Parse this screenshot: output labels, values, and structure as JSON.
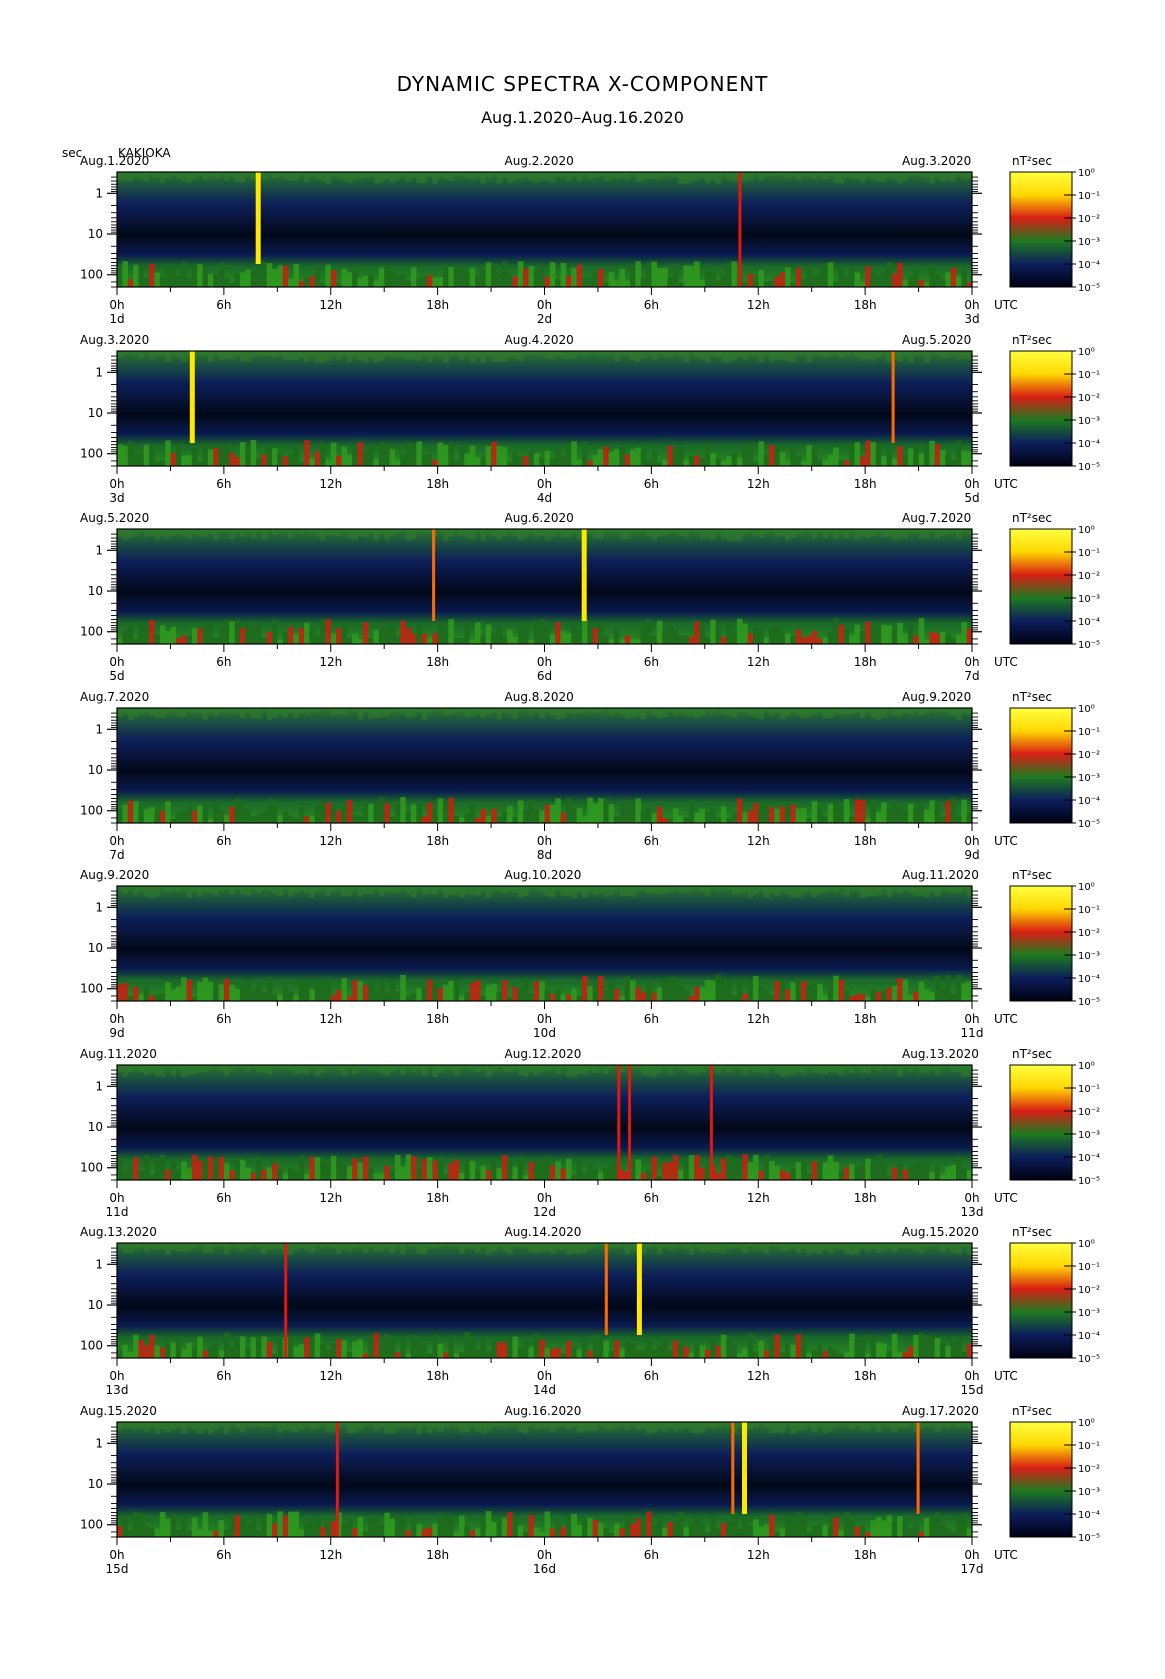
{
  "title": "DYNAMIC SPECTRA X-COMPONENT",
  "subtitle": "Aug.1.2020–Aug.16.2020",
  "y_axis_unit": "sec",
  "station": "KAKIOKA",
  "colorbar_unit": "nT²sec",
  "time_unit": "UTC",
  "chart_data": {
    "type": "heatmap",
    "y_scale": "log",
    "y_inverted": true,
    "y_ticks": [
      "1",
      "10",
      "100"
    ],
    "x_ticks": [
      "0h",
      "6h",
      "12h",
      "18h",
      "0h",
      "6h",
      "12h",
      "18h",
      "0h"
    ],
    "colorbar_ticks": [
      "10⁰",
      "10⁻¹",
      "10⁻²",
      "10⁻³",
      "10⁻⁴",
      "10⁻⁵"
    ],
    "colorscale": [
      "#000010",
      "#0c1e5c",
      "#1e7a20",
      "#d81e14",
      "#ffd700",
      "#ffff40"
    ],
    "panels": [
      {
        "left_date": "Aug.1.2020",
        "mid_date": "Aug.2.2020",
        "right_date": "Aug.3.2020",
        "day_labels": [
          "1d",
          "2d",
          "3d"
        ],
        "events": [
          {
            "hour": 7.9,
            "level": "yellow"
          },
          {
            "hour": 35.0,
            "level": "red"
          }
        ]
      },
      {
        "left_date": "Aug.3.2020",
        "mid_date": "Aug.4.2020",
        "right_date": "Aug.5.2020",
        "day_labels": [
          "3d",
          "4d",
          "5d"
        ],
        "events": [
          {
            "hour": 4.2,
            "level": "yellow"
          },
          {
            "hour": 43.6,
            "level": "orange"
          }
        ]
      },
      {
        "left_date": "Aug.5.2020",
        "mid_date": "Aug.6.2020",
        "right_date": "Aug.7.2020",
        "day_labels": [
          "5d",
          "6d",
          "7d"
        ],
        "events": [
          {
            "hour": 17.8,
            "level": "orange"
          },
          {
            "hour": 26.2,
            "level": "yellow"
          }
        ]
      },
      {
        "left_date": "Aug.7.2020",
        "mid_date": "Aug.8.2020",
        "right_date": "Aug.9.2020",
        "day_labels": [
          "7d",
          "8d",
          "9d"
        ],
        "events": []
      },
      {
        "left_date": "Aug.9.2020",
        "mid_date": "Aug.10.2020",
        "right_date": "Aug.11.2020",
        "day_labels": [
          "9d",
          "10d",
          "11d"
        ],
        "events": []
      },
      {
        "left_date": "Aug.11.2020",
        "mid_date": "Aug.12.2020",
        "right_date": "Aug.13.2020",
        "day_labels": [
          "11d",
          "12d",
          "13d"
        ],
        "events": [
          {
            "hour": 28.2,
            "level": "red"
          },
          {
            "hour": 28.8,
            "level": "red"
          },
          {
            "hour": 33.4,
            "level": "red"
          }
        ]
      },
      {
        "left_date": "Aug.13.2020",
        "mid_date": "Aug.14.2020",
        "right_date": "Aug.15.2020",
        "day_labels": [
          "13d",
          "14d",
          "15d"
        ],
        "events": [
          {
            "hour": 9.5,
            "level": "red"
          },
          {
            "hour": 27.5,
            "level": "orange"
          },
          {
            "hour": 29.3,
            "level": "yellow"
          }
        ]
      },
      {
        "left_date": "Aug.15.2020",
        "mid_date": "Aug.16.2020",
        "right_date": "Aug.17.2020",
        "day_labels": [
          "15d",
          "16d",
          "17d"
        ],
        "events": [
          {
            "hour": 12.4,
            "level": "red"
          },
          {
            "hour": 34.6,
            "level": "orange"
          },
          {
            "hour": 35.2,
            "level": "yellow"
          },
          {
            "hour": 45.0,
            "level": "orange"
          }
        ]
      }
    ]
  }
}
